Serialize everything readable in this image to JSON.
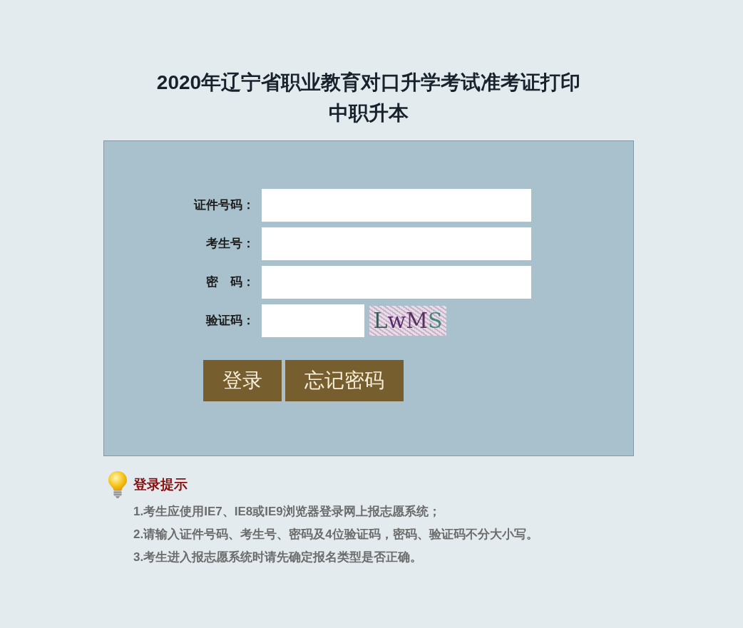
{
  "title": "2020年辽宁省职业教育对口升学考试准考证打印",
  "subtitle": "中职升本",
  "form": {
    "fields": [
      {
        "label": "证件号码：",
        "kind": "text"
      },
      {
        "label": "考生号：",
        "kind": "text"
      },
      {
        "label": "密　码：",
        "kind": "password"
      },
      {
        "label": "验证码：",
        "kind": "captcha",
        "captcha": "LwMS"
      }
    ],
    "buttons": [
      "登录",
      "忘记密码"
    ]
  },
  "tips": {
    "heading": "登录提示",
    "items": [
      "1.考生应使用IE7、IE8或IE9浏览器登录网上报志愿系统；",
      "2.请输入证件号码、考生号、密码及4位验证码，密码、验证码不分大小写。",
      "3.考生进入报志愿系统时请先确定报名类型是否正确。"
    ]
  }
}
